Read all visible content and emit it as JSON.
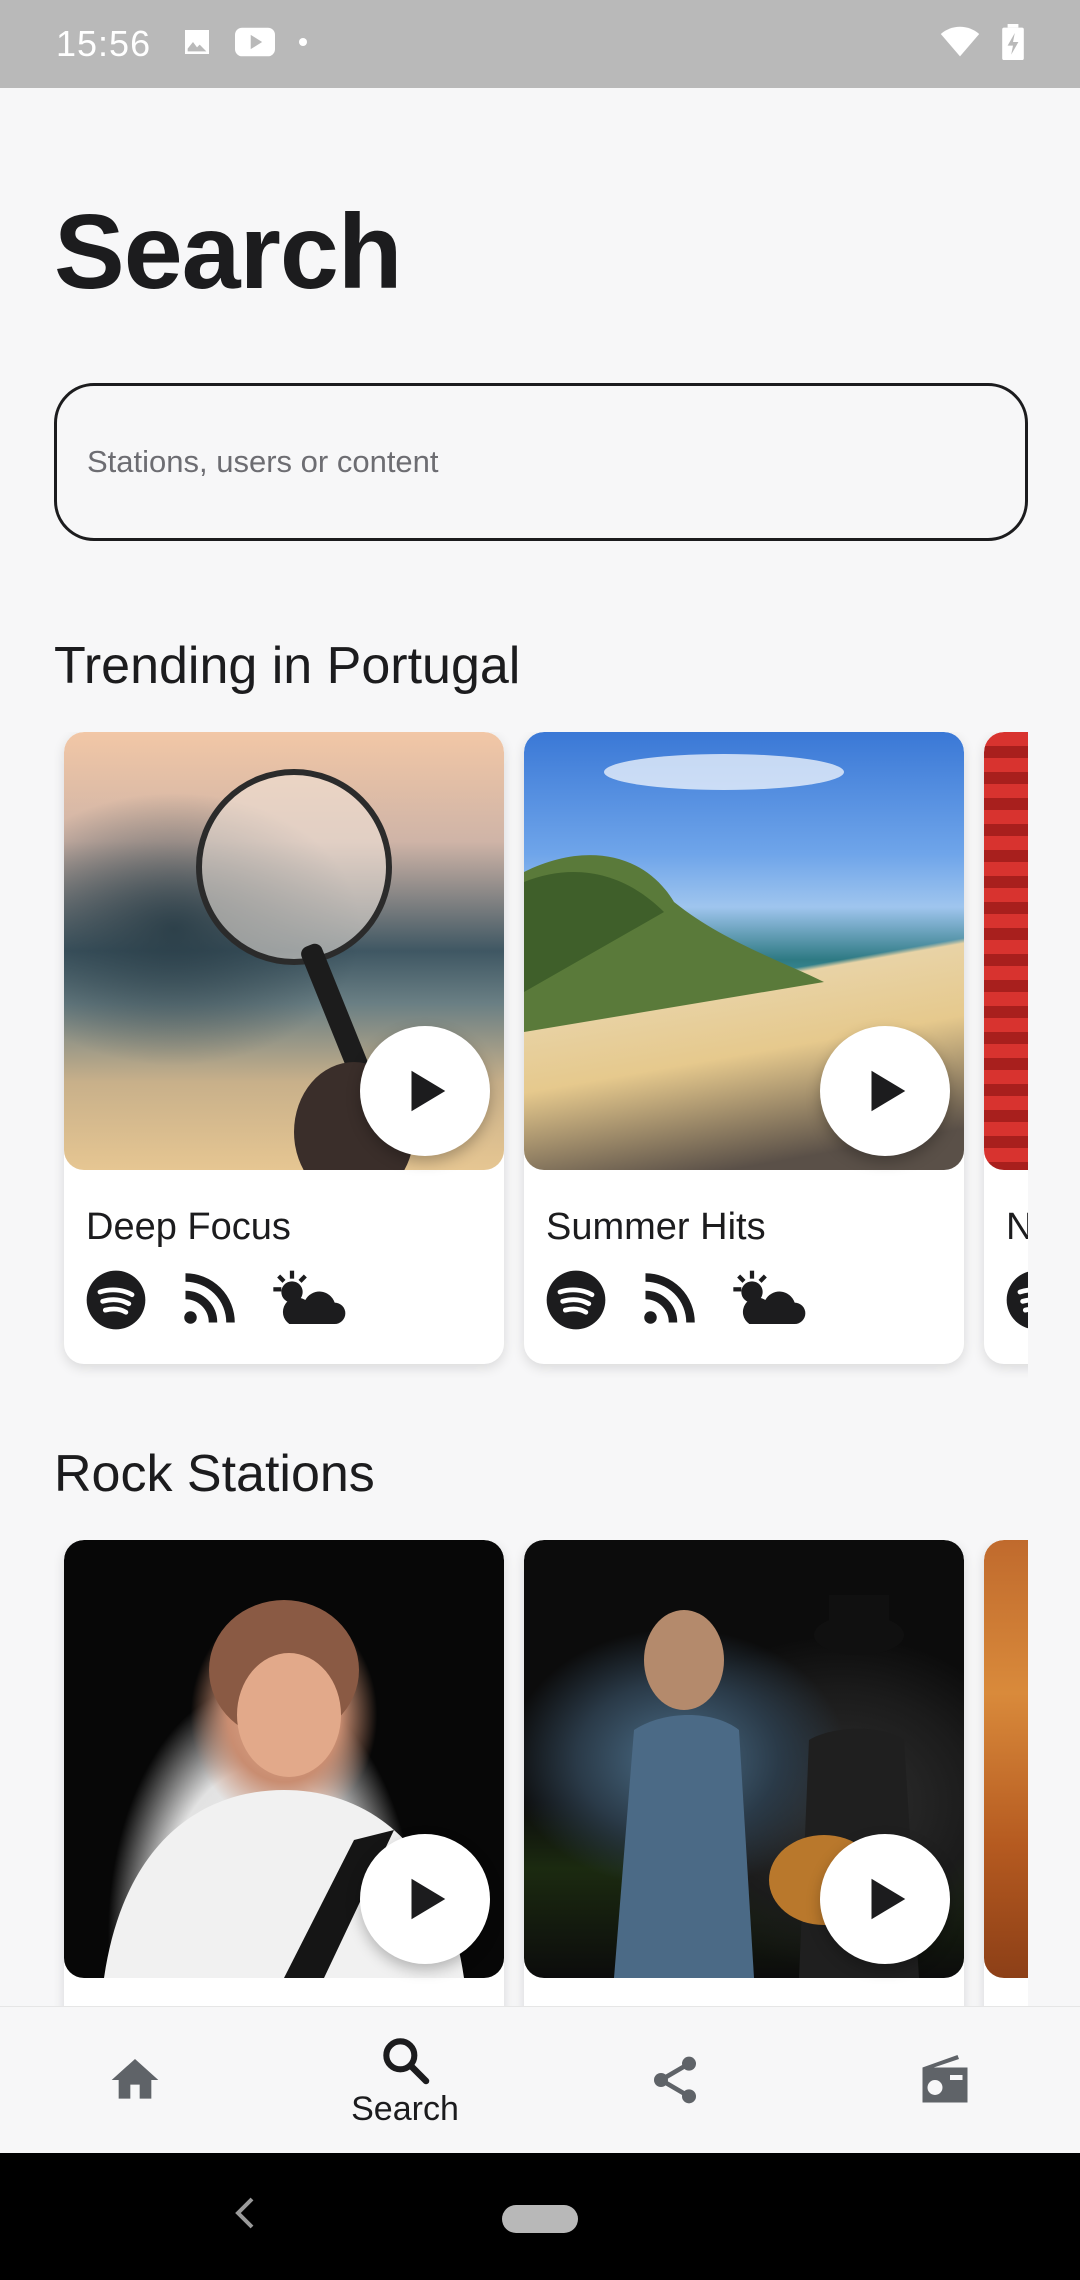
{
  "status_bar": {
    "time": "15:56",
    "left_icons": [
      "image-icon",
      "youtube-icon",
      "dot-icon"
    ],
    "right_icons": [
      "wifi-icon",
      "battery-charging-icon"
    ]
  },
  "page": {
    "title": "Search"
  },
  "search": {
    "placeholder": "Stations, users or content",
    "value": ""
  },
  "sections": [
    {
      "title": "Trending in Portugal",
      "cards": [
        {
          "title": "Deep Focus",
          "image": "magnifying-glass-photo",
          "icons": [
            "spotify-icon",
            "rss-icon",
            "weather-icon"
          ]
        },
        {
          "title": "Summer Hits",
          "image": "beach-photo",
          "icons": [
            "spotify-icon",
            "rss-icon",
            "weather-icon"
          ]
        },
        {
          "title": "N",
          "image": "stadium-photo",
          "icons": [
            "spotify-icon"
          ]
        }
      ]
    },
    {
      "title": "Rock Stations",
      "cards": [
        {
          "title": "",
          "image": "guitarist-photo"
        },
        {
          "title": "",
          "image": "concert-photo"
        },
        {
          "title": "",
          "image": "desert-photo"
        }
      ]
    }
  ],
  "bottom_nav": {
    "items": [
      {
        "icon": "home-icon",
        "label": ""
      },
      {
        "icon": "search-icon",
        "label": "Search"
      },
      {
        "icon": "share-icon",
        "label": ""
      },
      {
        "icon": "radio-icon",
        "label": ""
      }
    ]
  },
  "colors": {
    "background": "#f7f7f8",
    "text": "#1c1c1e",
    "status_bar": "#b9b9b9",
    "icon": "#1c1c1e",
    "nav_icon_inactive": "#5f6368"
  }
}
